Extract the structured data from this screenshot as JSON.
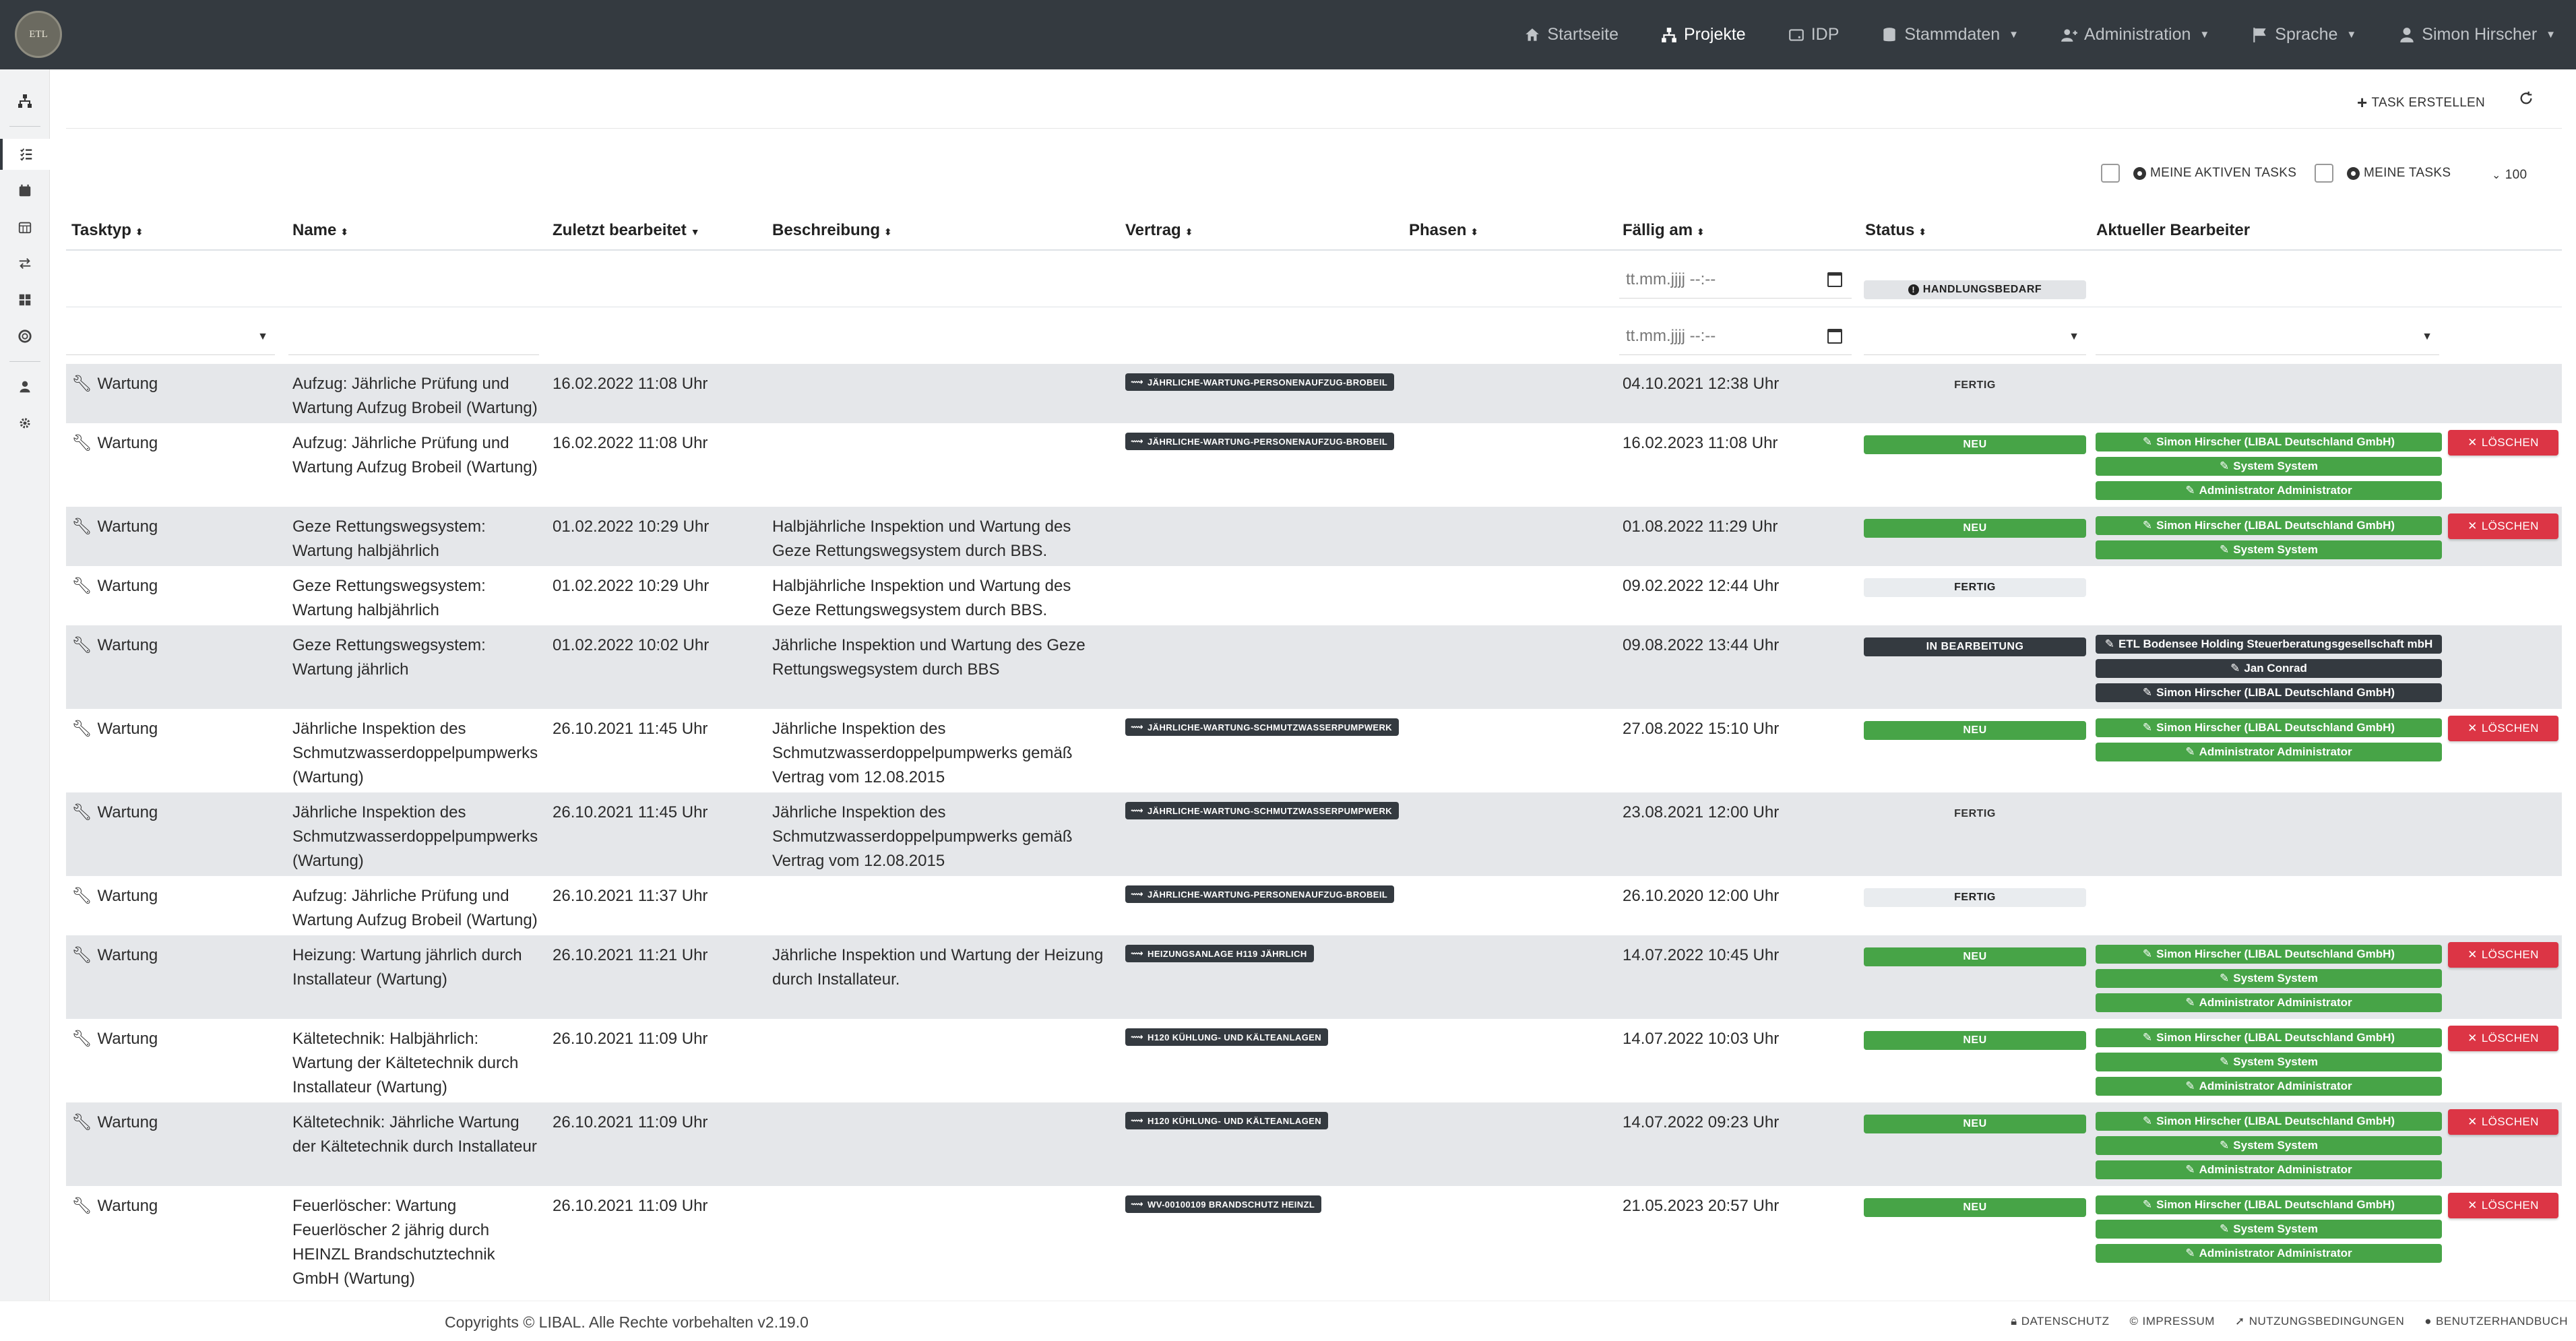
{
  "brand": {
    "logo_text": "ETL"
  },
  "nav": {
    "startseite": "Startseite",
    "projekte": "Projekte",
    "idp": "IDP",
    "stammdaten": "Stammdaten",
    "administration": "Administration",
    "sprache": "Sprache",
    "user": "Simon Hirscher"
  },
  "toolbar": {
    "create_task": "TASK ERSTELLEN",
    "my_active_tasks": "MEINE AKTIVEN TASKS",
    "my_tasks": "MEINE TASKS",
    "page_size": "100"
  },
  "columns": {
    "tasktyp": "Tasktyp",
    "name": "Name",
    "zuletzt": "Zuletzt bearbeitet",
    "beschreibung": "Beschreibung",
    "vertrag": "Vertrag",
    "phasen": "Phasen",
    "faellig": "Fällig am",
    "status": "Status",
    "bearbeiter": "Aktueller Bearbeiter"
  },
  "filters": {
    "date_placeholder": "tt.mm.jjjj --:--",
    "status_badge": "HANDLUNGSBEDARF"
  },
  "delete_label": "LÖSCHEN",
  "rows": [
    {
      "typ": "Wartung",
      "name": [
        "Aufzug: Jährliche Prüfung und",
        "Wartung Aufzug Brobeil (Wartung)"
      ],
      "zuletzt": "16.02.2022 11:08 Uhr",
      "beschreibung": [],
      "vertrag": "JÄHRLICHE-WARTUNG-PERSONENAUFZUG-BROBEIL",
      "faellig": "04.10.2021 12:38 Uhr",
      "status": "FERTIG",
      "status_style": "plain",
      "editors": [],
      "delete": false
    },
    {
      "typ": "Wartung",
      "name": [
        "Aufzug: Jährliche Prüfung und",
        "Wartung Aufzug Brobeil (Wartung)"
      ],
      "zuletzt": "16.02.2022 11:08 Uhr",
      "beschreibung": [],
      "vertrag": "JÄHRLICHE-WARTUNG-PERSONENAUFZUG-BROBEIL",
      "faellig": "16.02.2023 11:08 Uhr",
      "status": "NEU",
      "status_style": "neu",
      "editors": [
        {
          "name": "Simon Hirscher (LIBAL Deutschland GmbH)",
          "color": "green"
        },
        {
          "name": "System System",
          "color": "green"
        },
        {
          "name": "Administrator Administrator",
          "color": "green"
        }
      ],
      "delete": true
    },
    {
      "typ": "Wartung",
      "name": [
        "Geze Rettungswegsystem:",
        "Wartung halbjährlich"
      ],
      "zuletzt": "01.02.2022 10:29 Uhr",
      "beschreibung": [
        "Halbjährliche Inspektion und Wartung des",
        "Geze Rettungswegsystem durch BBS."
      ],
      "vertrag": "",
      "faellig": "01.08.2022 11:29 Uhr",
      "status": "NEU",
      "status_style": "neu",
      "editors": [
        {
          "name": "Simon Hirscher (LIBAL Deutschland GmbH)",
          "color": "green"
        },
        {
          "name": "System System",
          "color": "green"
        }
      ],
      "delete": true
    },
    {
      "typ": "Wartung",
      "name": [
        "Geze Rettungswegsystem:",
        "Wartung halbjährlich"
      ],
      "zuletzt": "01.02.2022 10:29 Uhr",
      "beschreibung": [
        "Halbjährliche Inspektion und Wartung des",
        "Geze Rettungswegsystem durch BBS."
      ],
      "vertrag": "",
      "faellig": "09.02.2022 12:44 Uhr",
      "status": "FERTIG",
      "status_style": "fertig",
      "editors": [],
      "delete": false
    },
    {
      "typ": "Wartung",
      "name": [
        "Geze Rettungswegsystem:",
        "Wartung jährlich"
      ],
      "zuletzt": "01.02.2022 10:02 Uhr",
      "beschreibung": [
        "Jährliche Inspektion und Wartung des Geze",
        "Rettungswegsystem durch BBS"
      ],
      "vertrag": "",
      "faellig": "09.08.2022 13:44 Uhr",
      "status": "IN BEARBEITUNG",
      "status_style": "bearb",
      "editors": [
        {
          "name": "ETL Bodensee Holding Steuerberatungsgesellschaft mbH",
          "color": "dark"
        },
        {
          "name": "Jan Conrad",
          "color": "dark"
        },
        {
          "name": "Simon Hirscher (LIBAL Deutschland GmbH)",
          "color": "dark"
        }
      ],
      "delete": false
    },
    {
      "typ": "Wartung",
      "name": [
        "Jährliche Inspektion des",
        "Schmutzwasserdoppelpumpwerks",
        "(Wartung)"
      ],
      "zuletzt": "26.10.2021 11:45 Uhr",
      "beschreibung": [
        "Jährliche Inspektion des",
        "Schmutzwasserdoppelpumpwerks gemäß",
        "Vertrag vom 12.08.2015"
      ],
      "vertrag": "JÄHRLICHE-WARTUNG-SCHMUTZWASSERPUMPWERK",
      "faellig": "27.08.2022 15:10 Uhr",
      "status": "NEU",
      "status_style": "neu",
      "editors": [
        {
          "name": "Simon Hirscher (LIBAL Deutschland GmbH)",
          "color": "green"
        },
        {
          "name": "Administrator Administrator",
          "color": "green"
        }
      ],
      "delete": true
    },
    {
      "typ": "Wartung",
      "name": [
        "Jährliche Inspektion des",
        "Schmutzwasserdoppelpumpwerks",
        "(Wartung)"
      ],
      "zuletzt": "26.10.2021 11:45 Uhr",
      "beschreibung": [
        "Jährliche Inspektion des",
        "Schmutzwasserdoppelpumpwerks gemäß",
        "Vertrag vom 12.08.2015"
      ],
      "vertrag": "JÄHRLICHE-WARTUNG-SCHMUTZWASSERPUMPWERK",
      "faellig": "23.08.2021 12:00 Uhr",
      "status": "FERTIG",
      "status_style": "plain",
      "editors": [],
      "delete": false
    },
    {
      "typ": "Wartung",
      "name": [
        "Aufzug: Jährliche Prüfung und",
        "Wartung Aufzug Brobeil (Wartung)"
      ],
      "zuletzt": "26.10.2021 11:37 Uhr",
      "beschreibung": [],
      "vertrag": "JÄHRLICHE-WARTUNG-PERSONENAUFZUG-BROBEIL",
      "faellig": "26.10.2020 12:00 Uhr",
      "status": "FERTIG",
      "status_style": "fertig",
      "editors": [],
      "delete": false
    },
    {
      "typ": "Wartung",
      "name": [
        "Heizung: Wartung jährlich durch",
        "Installateur (Wartung)"
      ],
      "zuletzt": "26.10.2021 11:21 Uhr",
      "beschreibung": [
        "Jährliche Inspektion und Wartung der Heizung",
        "durch Installateur."
      ],
      "vertrag": "HEIZUNGSANLAGE H119 JÄHRLICH",
      "faellig": "14.07.2022 10:45 Uhr",
      "status": "NEU",
      "status_style": "neu",
      "editors": [
        {
          "name": "Simon Hirscher (LIBAL Deutschland GmbH)",
          "color": "green"
        },
        {
          "name": "System System",
          "color": "green"
        },
        {
          "name": "Administrator Administrator",
          "color": "green"
        }
      ],
      "delete": true
    },
    {
      "typ": "Wartung",
      "name": [
        "Kältetechnik: Halbjährlich:",
        "Wartung der Kältetechnik durch",
        "Installateur (Wartung)"
      ],
      "zuletzt": "26.10.2021 11:09 Uhr",
      "beschreibung": [],
      "vertrag": "H120 KÜHLUNG- UND KÄLTEANLAGEN",
      "faellig": "14.07.2022 10:03 Uhr",
      "status": "NEU",
      "status_style": "neu",
      "editors": [
        {
          "name": "Simon Hirscher (LIBAL Deutschland GmbH)",
          "color": "green"
        },
        {
          "name": "System System",
          "color": "green"
        },
        {
          "name": "Administrator Administrator",
          "color": "green"
        }
      ],
      "delete": true
    },
    {
      "typ": "Wartung",
      "name": [
        "Kältetechnik: Jährliche Wartung",
        "der Kältetechnik durch Installateur"
      ],
      "zuletzt": "26.10.2021 11:09 Uhr",
      "beschreibung": [],
      "vertrag": "H120 KÜHLUNG- UND KÄLTEANLAGEN",
      "faellig": "14.07.2022 09:23 Uhr",
      "status": "NEU",
      "status_style": "neu",
      "editors": [
        {
          "name": "Simon Hirscher (LIBAL Deutschland GmbH)",
          "color": "green"
        },
        {
          "name": "System System",
          "color": "green"
        },
        {
          "name": "Administrator Administrator",
          "color": "green"
        }
      ],
      "delete": true
    },
    {
      "typ": "Wartung",
      "name": [
        "Feuerlöscher: Wartung",
        "Feuerlöscher 2 jährig durch",
        "HEINZL Brandschutztechnik",
        "GmbH (Wartung)"
      ],
      "zuletzt": "26.10.2021 11:09 Uhr",
      "beschreibung": [],
      "vertrag": "WV-00100109 BRANDSCHUTZ HEINZL",
      "faellig": "21.05.2023 20:57 Uhr",
      "status": "NEU",
      "status_style": "neu",
      "editors": [
        {
          "name": "Simon Hirscher (LIBAL Deutschland GmbH)",
          "color": "green"
        },
        {
          "name": "System System",
          "color": "green"
        },
        {
          "name": "Administrator Administrator",
          "color": "green"
        }
      ],
      "delete": true
    }
  ],
  "footer": {
    "copyright": "Copyrights © LIBAL. Alle Rechte vorbehalten  v2.19.0",
    "datenschutz": "DATENSCHUTZ",
    "impressum": "IMPRESSUM",
    "nutzung": "NUTZUNGSBEDINGUNGEN",
    "handbuch": "BENUTZERHANDBUCH"
  }
}
